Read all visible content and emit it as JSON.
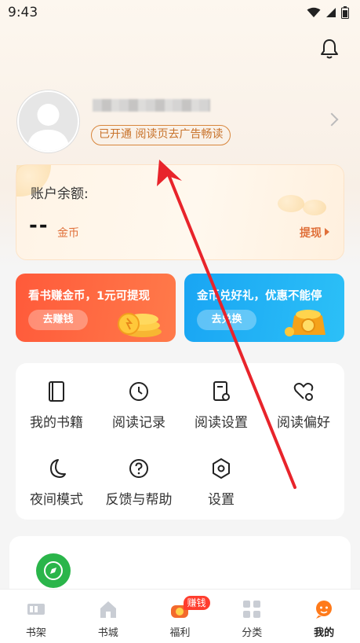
{
  "status_bar": {
    "time": "9:43"
  },
  "profile": {
    "vip_text": "已开通 阅读页去广告畅读"
  },
  "balance": {
    "label": "账户余额:",
    "value": "--",
    "unit": "金币",
    "withdraw_label": "提现"
  },
  "promos": [
    {
      "title": "看书赚金币，1元可提现",
      "button": "去赚钱",
      "color": "#ff5a3a"
    },
    {
      "title": "金币兑好礼，优惠不能停",
      "button": "去兑换",
      "color": "#19a5f3"
    }
  ],
  "menu": [
    {
      "label": "我的书籍",
      "icon": "book-icon"
    },
    {
      "label": "阅读记录",
      "icon": "clock-icon"
    },
    {
      "label": "阅读设置",
      "icon": "doc-settings-icon"
    },
    {
      "label": "阅读偏好",
      "icon": "heart-settings-icon"
    },
    {
      "label": "夜间模式",
      "icon": "moon-icon"
    },
    {
      "label": "反馈与帮助",
      "icon": "question-icon"
    },
    {
      "label": "设置",
      "icon": "hexagon-icon"
    }
  ],
  "nav": [
    {
      "label": "书架",
      "icon": "bookshelf-icon"
    },
    {
      "label": "书城",
      "icon": "home-icon"
    },
    {
      "label": "福利",
      "icon": "welfare-icon",
      "badge": "赚钱"
    },
    {
      "label": "分类",
      "icon": "category-icon"
    },
    {
      "label": "我的",
      "icon": "mine-icon",
      "active": true
    }
  ],
  "colors": {
    "accent_orange": "#e0703a",
    "vip_border": "#d8863c",
    "annotation_arrow": "#e8242b",
    "app_green": "#2ab54a"
  }
}
